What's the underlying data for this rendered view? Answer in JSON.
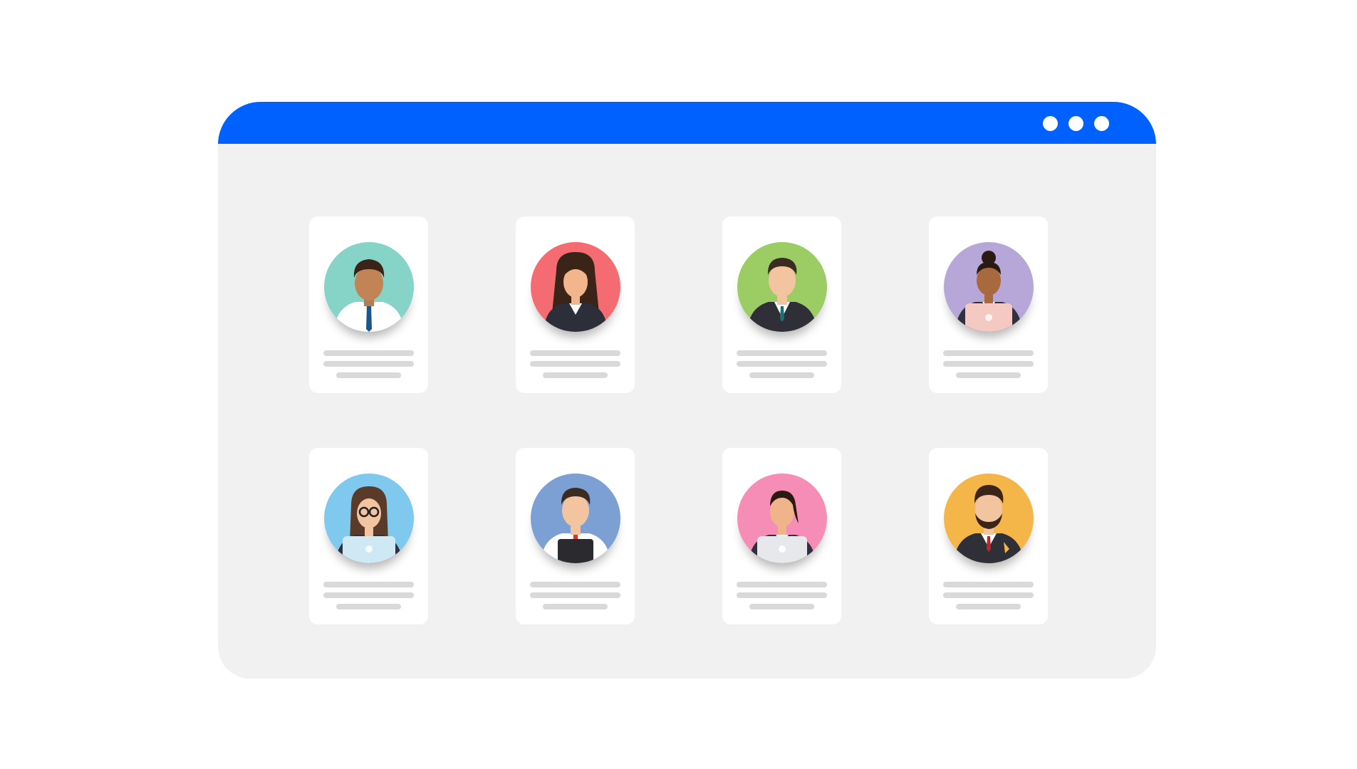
{
  "window": {
    "titlebar_color": "#0061fe",
    "controls": [
      "dot",
      "dot",
      "dot"
    ]
  },
  "cards": [
    {
      "person": "man-white-shirt-blue-tie",
      "bg": "#86d3c7"
    },
    {
      "person": "woman-long-hair-suit",
      "bg": "#f46c72"
    },
    {
      "person": "man-dark-suit-teal-tie",
      "bg": "#9ccd65"
    },
    {
      "person": "woman-hair-bun-laptop",
      "bg": "#b7a6d8"
    },
    {
      "person": "woman-glasses-laptop",
      "bg": "#7fc9ee"
    },
    {
      "person": "man-red-tie-tablet",
      "bg": "#7c9fd4"
    },
    {
      "person": "woman-ponytail-laptop",
      "bg": "#f58db6"
    },
    {
      "person": "man-beard-dark-suit",
      "bg": "#f4b549"
    }
  ]
}
